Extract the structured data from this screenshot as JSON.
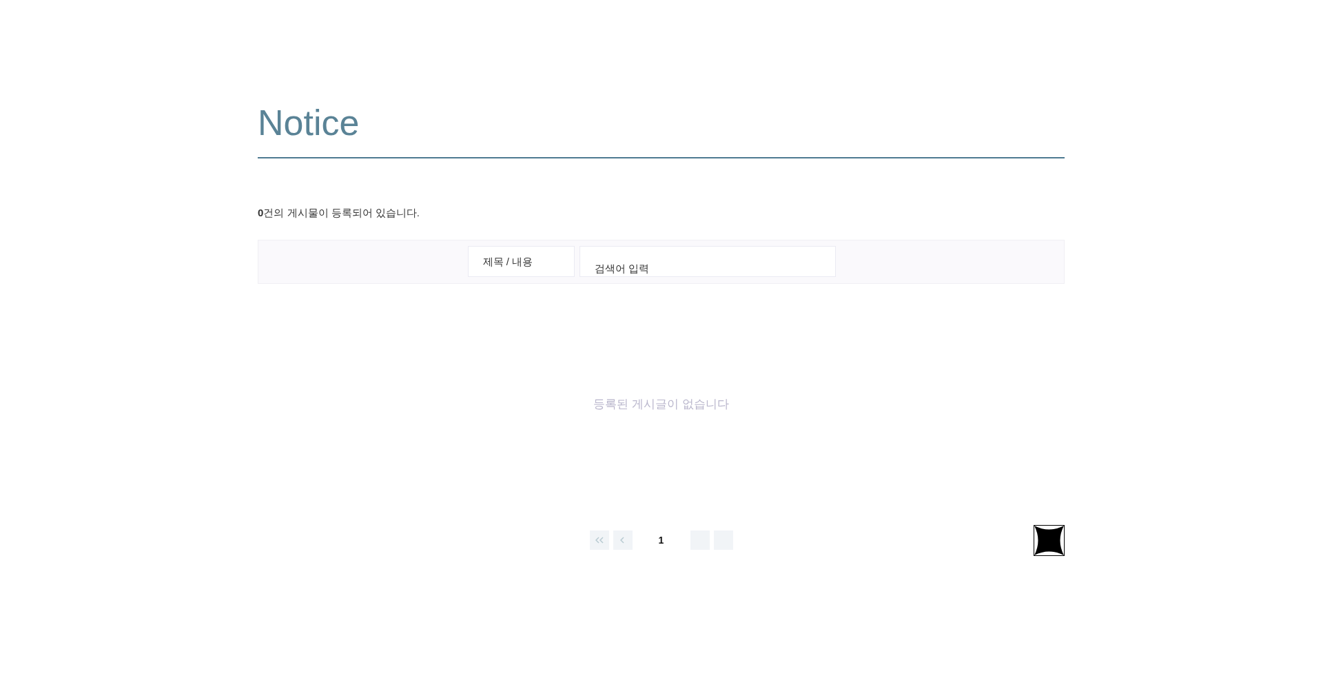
{
  "title": "Notice",
  "count_text": "**0**건의 게시물이 등록되어 있습니다.",
  "search": {
    "category": "제목 / 내용",
    "placeholder": "검색어 입력"
  },
  "empty_message": "등록된 게시글이 없습니다",
  "pagination": {
    "pages": [
      {
        "label": "1",
        "selected": true
      }
    ]
  }
}
